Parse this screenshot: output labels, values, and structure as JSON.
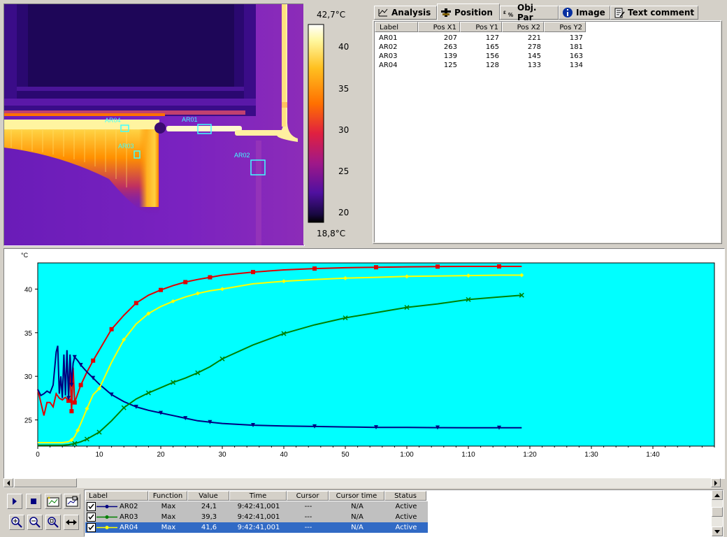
{
  "scale": {
    "max": "42,7°C",
    "min": "18,8°C",
    "ticks": [
      "40",
      "35",
      "30",
      "25",
      "20"
    ]
  },
  "regions": [
    {
      "label": "AR04"
    },
    {
      "label": "AR01"
    },
    {
      "label": "AR03"
    },
    {
      "label": "AR02"
    }
  ],
  "tabs": [
    {
      "label": "Analysis",
      "icon": "analysis-icon"
    },
    {
      "label": "Position",
      "icon": "position-icon"
    },
    {
      "label": "Obj. Par",
      "icon": "object-parameters-icon"
    },
    {
      "label": "Image",
      "icon": "info-icon"
    },
    {
      "label": "Text comment",
      "icon": "text-comment-icon"
    }
  ],
  "active_tab": "Position",
  "position_table": {
    "headers": [
      "Label",
      "Pos X1",
      "Pos Y1",
      "Pos X2",
      "Pos Y2"
    ],
    "rows": [
      [
        "AR01",
        "207",
        "127",
        "221",
        "137"
      ],
      [
        "AR02",
        "263",
        "165",
        "278",
        "181"
      ],
      [
        "AR03",
        "139",
        "156",
        "145",
        "163"
      ],
      [
        "AR04",
        "125",
        "128",
        "133",
        "134"
      ]
    ]
  },
  "chart_data": {
    "type": "line",
    "ylabel": "°C",
    "xlabel": "",
    "xlim": [
      0,
      6600
    ],
    "ylim": [
      22,
      43
    ],
    "y_ticks": [
      25,
      30,
      35,
      40
    ],
    "x_ticks": [
      {
        "v": 0,
        "label": "0"
      },
      {
        "v": 600,
        "label": "10"
      },
      {
        "v": 1200,
        "label": "20"
      },
      {
        "v": 1800,
        "label": "30"
      },
      {
        "v": 2400,
        "label": "40"
      },
      {
        "v": 3000,
        "label": "50"
      },
      {
        "v": 3600,
        "label": "1:00"
      },
      {
        "v": 4200,
        "label": "1:10"
      },
      {
        "v": 4800,
        "label": "1:20"
      },
      {
        "v": 5400,
        "label": "1:30"
      },
      {
        "v": 6000,
        "label": "1:40"
      }
    ],
    "background": "#00ffff",
    "series": [
      {
        "name": "AR01",
        "color": "#e00000",
        "marker": "square",
        "x": [
          0,
          30,
          60,
          90,
          120,
          150,
          180,
          210,
          240,
          270,
          300,
          315,
          330,
          345,
          360,
          390,
          420,
          480,
          540,
          600,
          720,
          840,
          960,
          1080,
          1200,
          1320,
          1440,
          1560,
          1680,
          1800,
          2100,
          2400,
          2700,
          3000,
          3300,
          3600,
          3900,
          4200,
          4500,
          4720
        ],
        "y": [
          28.5,
          27,
          25.5,
          27,
          27,
          26.5,
          28,
          27.5,
          27.3,
          27.6,
          27.2,
          31,
          26,
          31,
          27,
          28,
          29,
          30.5,
          31.8,
          33,
          35.4,
          37,
          38.4,
          39.3,
          39.9,
          40.4,
          40.8,
          41.1,
          41.35,
          41.6,
          41.95,
          42.2,
          42.35,
          42.45,
          42.5,
          42.55,
          42.58,
          42.6,
          42.6,
          42.6
        ]
      },
      {
        "name": "AR02",
        "color": "#000080",
        "marker": "triangle-down",
        "x": [
          0,
          30,
          60,
          90,
          120,
          150,
          180,
          195,
          210,
          225,
          240,
          255,
          270,
          285,
          300,
          315,
          330,
          345,
          360,
          390,
          420,
          480,
          540,
          600,
          720,
          840,
          960,
          1080,
          1200,
          1320,
          1440,
          1560,
          1680,
          1800,
          2100,
          2400,
          2700,
          3000,
          3300,
          3600,
          3900,
          4200,
          4500,
          4720
        ],
        "y": [
          28.5,
          27.8,
          28,
          28.3,
          28.1,
          29,
          32.8,
          33.5,
          28,
          30,
          27.5,
          32.5,
          27.8,
          33,
          27.5,
          32.5,
          29,
          31.5,
          32.2,
          31.8,
          31.3,
          30.5,
          29.8,
          29.1,
          27.9,
          27.1,
          26.5,
          26.1,
          25.8,
          25.5,
          25.2,
          24.9,
          24.75,
          24.6,
          24.4,
          24.3,
          24.25,
          24.2,
          24.15,
          24.15,
          24.12,
          24.1,
          24.1,
          24.1
        ]
      },
      {
        "name": "AR03",
        "color": "#008000",
        "marker": "x",
        "x": [
          0,
          120,
          240,
          300,
          360,
          420,
          480,
          540,
          600,
          720,
          840,
          960,
          1080,
          1200,
          1320,
          1440,
          1560,
          1680,
          1800,
          2100,
          2400,
          2700,
          3000,
          3300,
          3600,
          3900,
          4200,
          4500,
          4720
        ],
        "y": [
          22.1,
          22.1,
          22.1,
          22.15,
          22.3,
          22.5,
          22.8,
          23.2,
          23.6,
          24.9,
          26.4,
          27.4,
          28.1,
          28.7,
          29.3,
          29.8,
          30.4,
          31.1,
          32,
          33.6,
          34.9,
          35.9,
          36.7,
          37.3,
          37.9,
          38.3,
          38.8,
          39.1,
          39.3
        ]
      },
      {
        "name": "AR04",
        "color": "#ffff00",
        "marker": "diamond",
        "x": [
          0,
          120,
          240,
          300,
          330,
          360,
          390,
          420,
          480,
          540,
          600,
          720,
          840,
          960,
          1080,
          1200,
          1320,
          1440,
          1560,
          1680,
          1800,
          2100,
          2400,
          2700,
          3000,
          3300,
          3600,
          3900,
          4200,
          4500,
          4720
        ],
        "y": [
          22.4,
          22.4,
          22.4,
          22.5,
          22.7,
          23.1,
          23.8,
          24.6,
          26.3,
          27.9,
          28.6,
          31.6,
          34.2,
          36,
          37.2,
          38,
          38.6,
          39.1,
          39.5,
          39.8,
          40,
          40.6,
          40.9,
          41.1,
          41.25,
          41.35,
          41.45,
          41.5,
          41.55,
          41.6,
          41.6
        ]
      }
    ]
  },
  "legend": {
    "headers": [
      "Label",
      "Function",
      "Value",
      "Time",
      "Cursor",
      "Cursor time",
      "Status"
    ],
    "rows": [
      {
        "label": "AR02",
        "function": "Max",
        "value": "24,1",
        "time": "9:42:41,001",
        "cursor": "---",
        "cursor_time": "N/A",
        "status": "Active",
        "color": "#000080",
        "selected": false
      },
      {
        "label": "AR03",
        "function": "Max",
        "value": "39,3",
        "time": "9:42:41,001",
        "cursor": "---",
        "cursor_time": "N/A",
        "status": "Active",
        "color": "#008000",
        "selected": false
      },
      {
        "label": "AR04",
        "function": "Max",
        "value": "41,6",
        "time": "9:42:41,001",
        "cursor": "---",
        "cursor_time": "N/A",
        "status": "Active",
        "color": "#ffff00",
        "selected": true
      }
    ]
  },
  "toolbar_icons": [
    "play-icon",
    "stop-icon",
    "chart-options-icon",
    "chart-settings-icon",
    "zoom-in-icon",
    "zoom-out-icon",
    "zoom-fit-icon",
    "resize-horizontal-icon"
  ]
}
